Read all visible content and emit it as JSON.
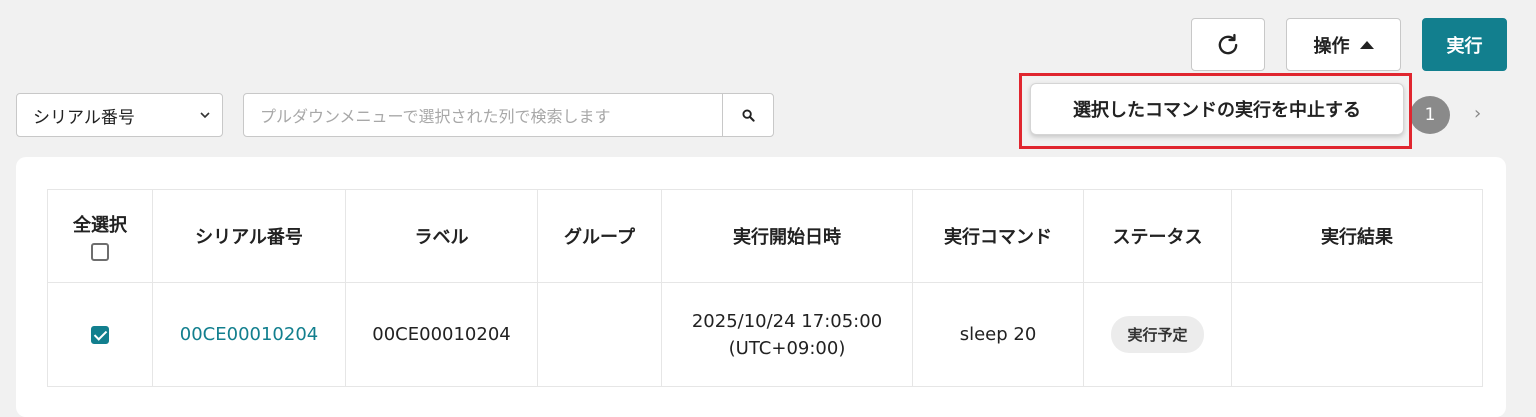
{
  "toolbar": {
    "refresh_icon": "refresh-icon",
    "ops_label": "操作",
    "run_label": "実行"
  },
  "dropdown_menu": {
    "item": "選択したコマンドの実行を中止する"
  },
  "filter": {
    "column_select_value": "シリアル番号",
    "search_placeholder": "プルダウンメニューで選択された列で検索します"
  },
  "pagination": {
    "current_page": "1",
    "next": "›"
  },
  "table": {
    "headers": {
      "select_all": "全選択",
      "serial": "シリアル番号",
      "label": "ラベル",
      "group": "グループ",
      "start": "実行開始日時",
      "command": "実行コマンド",
      "status": "ステータス",
      "result": "実行結果"
    },
    "rows": [
      {
        "checked": true,
        "serial": "00CE00010204",
        "label": "00CE00010204",
        "group": "",
        "start_date": "2025/10/24 17:05:00",
        "start_tz": "(UTC+09:00)",
        "command": "sleep 20",
        "status": "実行予定",
        "result": ""
      }
    ]
  },
  "colors": {
    "accent": "#127f8e",
    "highlight": "#e0262f"
  }
}
